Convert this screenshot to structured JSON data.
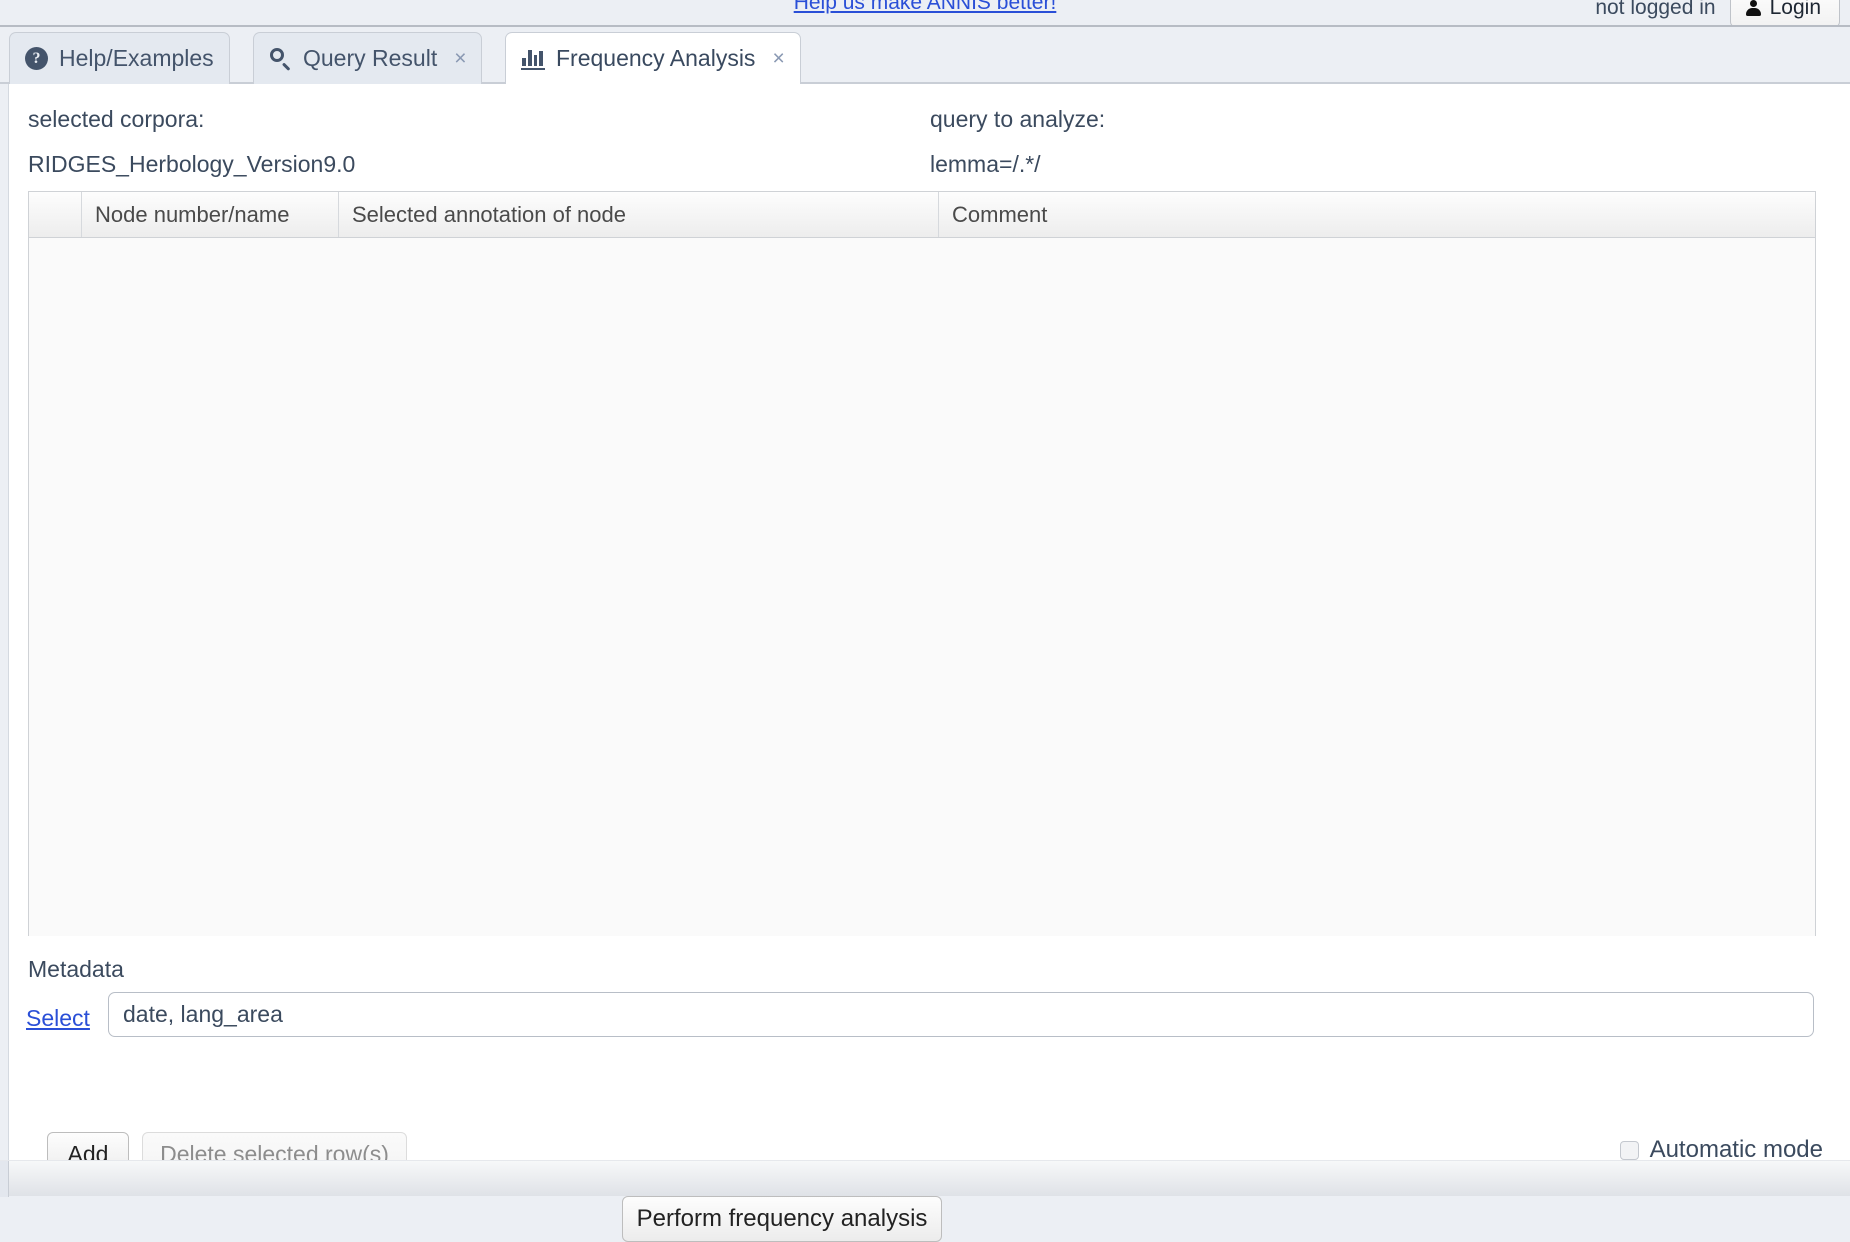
{
  "topbar": {
    "feedback_link": "Help us make ANNIS better!",
    "login_status": "not logged in",
    "login_button": "Login",
    "user_icon": "user-icon"
  },
  "tabs": [
    {
      "id": "help",
      "label": "Help/Examples",
      "icon": "help-circle-icon",
      "active": false,
      "closable": false
    },
    {
      "id": "query",
      "label": "Query Result",
      "icon": "search-icon",
      "active": false,
      "closable": true,
      "close_glyph": "×"
    },
    {
      "id": "freq",
      "label": "Frequency Analysis",
      "icon": "bar-chart-icon",
      "active": true,
      "closable": true,
      "close_glyph": "×"
    }
  ],
  "main": {
    "corpora_label": "selected corpora:",
    "corpora_value": "RIDGES_Herbology_Version9.0",
    "query_label": "query to analyze:",
    "query_value": "lemma=/.*/",
    "table": {
      "columns": [
        "",
        "Node number/name",
        "Selected annotation of node",
        "Comment"
      ],
      "rows": []
    },
    "metadata_label": "Metadata",
    "select_link": "Select",
    "metadata_value": "date, lang_area",
    "metadata_placeholder": "",
    "add_button": "Add",
    "delete_button": "Delete selected row(s)",
    "automatic_mode_label": "Automatic mode",
    "automatic_mode_checked": false,
    "perform_button": "Perform frequency analysis"
  },
  "colors": {
    "page_bg": "#eceff4",
    "panel_bg": "#ffffff",
    "link": "#2a4fd7",
    "text": "#3b4a5e",
    "tab_active_bg": "#ffffff",
    "tab_inactive_bg": "#e4e9f0"
  }
}
